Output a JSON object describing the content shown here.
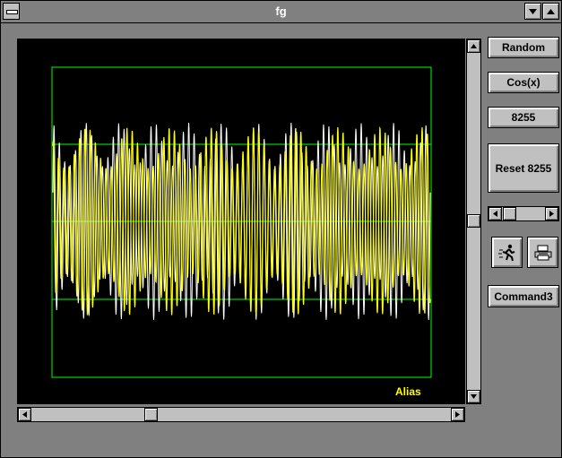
{
  "window": {
    "title": "fg"
  },
  "buttons": {
    "random": "Random",
    "cos": "Cos(x)",
    "chip": "8255",
    "reset": "Reset 8255",
    "command3": "Command3"
  },
  "plot": {
    "label": "Alias",
    "trace_color": "#ffff00",
    "grid_color": "#00ff00",
    "background": "#000000"
  },
  "icons": {
    "run": "running-man-icon",
    "print": "printer-icon"
  }
}
